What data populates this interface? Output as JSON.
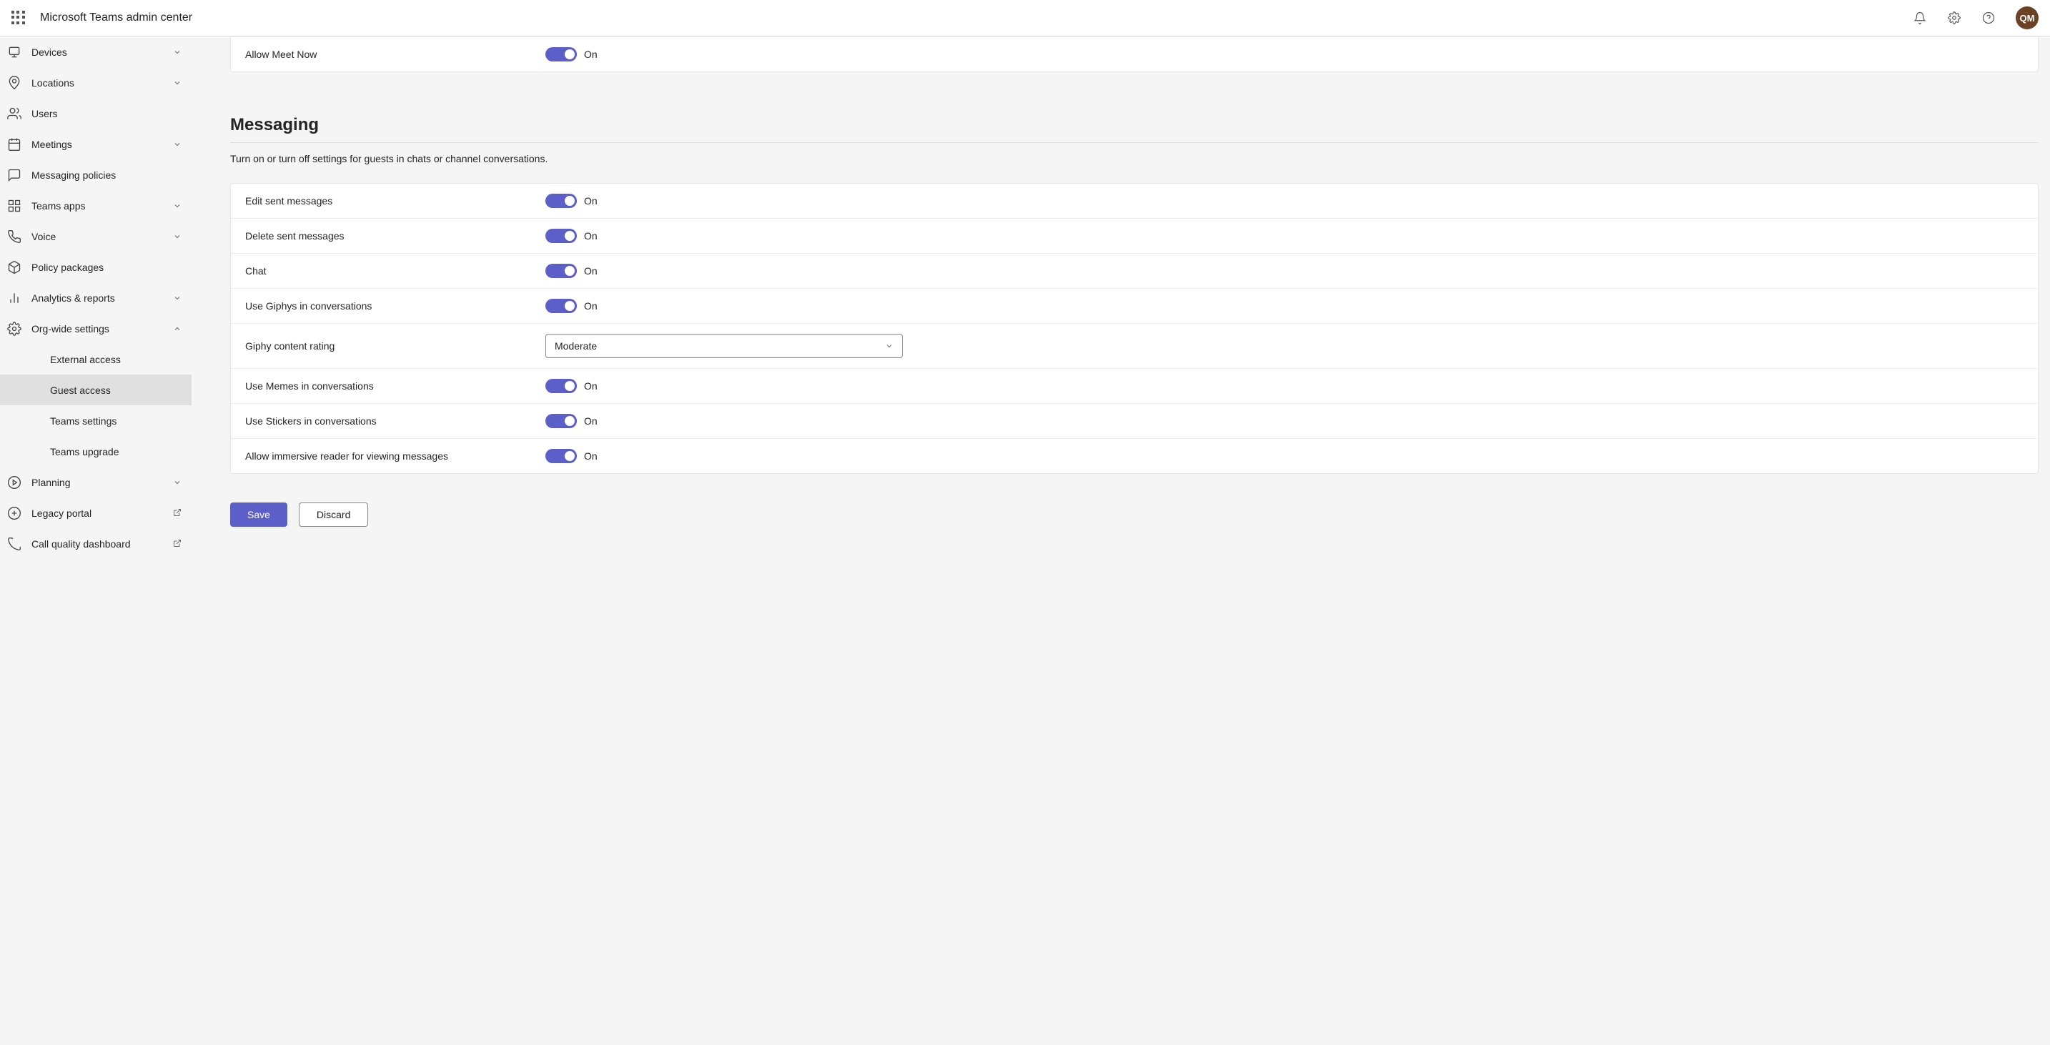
{
  "header": {
    "title": "Microsoft Teams admin center",
    "avatar_initials": "QM"
  },
  "sidebar": {
    "items": [
      {
        "label": "Devices",
        "icon": "devices-icon",
        "expandable": true,
        "sub": false
      },
      {
        "label": "Locations",
        "icon": "location-icon",
        "expandable": true,
        "sub": false
      },
      {
        "label": "Users",
        "icon": "users-icon",
        "expandable": false,
        "sub": false
      },
      {
        "label": "Meetings",
        "icon": "calendar-icon",
        "expandable": true,
        "sub": false
      },
      {
        "label": "Messaging policies",
        "icon": "chat-icon",
        "expandable": false,
        "sub": false
      },
      {
        "label": "Teams apps",
        "icon": "apps-icon",
        "expandable": true,
        "sub": false
      },
      {
        "label": "Voice",
        "icon": "phone-icon",
        "expandable": true,
        "sub": false
      },
      {
        "label": "Policy packages",
        "icon": "package-icon",
        "expandable": false,
        "sub": false
      },
      {
        "label": "Analytics & reports",
        "icon": "analytics-icon",
        "expandable": true,
        "sub": false
      },
      {
        "label": "Org-wide settings",
        "icon": "settings-icon",
        "expandable": true,
        "expanded": true,
        "sub": false
      },
      {
        "label": "External access",
        "icon": "",
        "expandable": false,
        "sub": true
      },
      {
        "label": "Guest access",
        "icon": "",
        "expandable": false,
        "sub": true,
        "active": true
      },
      {
        "label": "Teams settings",
        "icon": "",
        "expandable": false,
        "sub": true
      },
      {
        "label": "Teams upgrade",
        "icon": "",
        "expandable": false,
        "sub": true
      },
      {
        "label": "Planning",
        "icon": "planning-icon",
        "expandable": true,
        "sub": false
      },
      {
        "label": "Legacy portal",
        "icon": "legacy-icon",
        "expandable": false,
        "sub": false,
        "external": true
      },
      {
        "label": "Call quality dashboard",
        "icon": "call-quality-icon",
        "expandable": false,
        "sub": false,
        "external": true
      }
    ]
  },
  "top_card": {
    "rows": [
      {
        "label": "Allow Meet Now",
        "state": "On"
      }
    ]
  },
  "section": {
    "title": "Messaging",
    "description": "Turn on or turn off settings for guests in chats or channel conversations."
  },
  "messaging_card": {
    "rows": [
      {
        "label": "Edit sent messages",
        "type": "toggle",
        "state": "On"
      },
      {
        "label": "Delete sent messages",
        "type": "toggle",
        "state": "On"
      },
      {
        "label": "Chat",
        "type": "toggle",
        "state": "On"
      },
      {
        "label": "Use Giphys in conversations",
        "type": "toggle",
        "state": "On"
      },
      {
        "label": "Giphy content rating",
        "type": "select",
        "value": "Moderate"
      },
      {
        "label": "Use Memes in conversations",
        "type": "toggle",
        "state": "On"
      },
      {
        "label": "Use Stickers in conversations",
        "type": "toggle",
        "state": "On"
      },
      {
        "label": "Allow immersive reader for viewing messages",
        "type": "toggle",
        "state": "On"
      }
    ]
  },
  "actions": {
    "save": "Save",
    "discard": "Discard"
  }
}
